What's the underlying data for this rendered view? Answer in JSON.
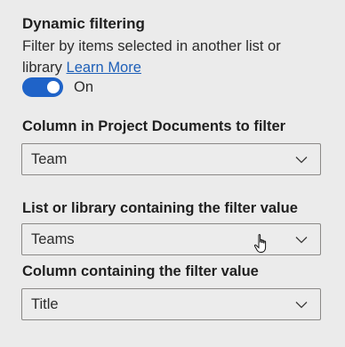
{
  "dynamic_filtering": {
    "title": "Dynamic filtering",
    "description": "Filter by items selected in another list or library",
    "learn_more": "Learn More",
    "toggle_state": "On",
    "toggle_on": true
  },
  "fields": [
    {
      "label": "Column in Project Documents to filter",
      "value": "Team"
    },
    {
      "label": "List or library containing the filter value",
      "value": "Teams"
    },
    {
      "label": "Column containing the filter value",
      "value": "Title"
    }
  ],
  "colors": {
    "accent": "#1f63c8",
    "link": "#1d5fb8",
    "background": "#ebebeb",
    "border": "#8a8886"
  },
  "icons": {
    "dropdown": "chevron-down-icon",
    "cursor": "hand-pointer-icon"
  }
}
